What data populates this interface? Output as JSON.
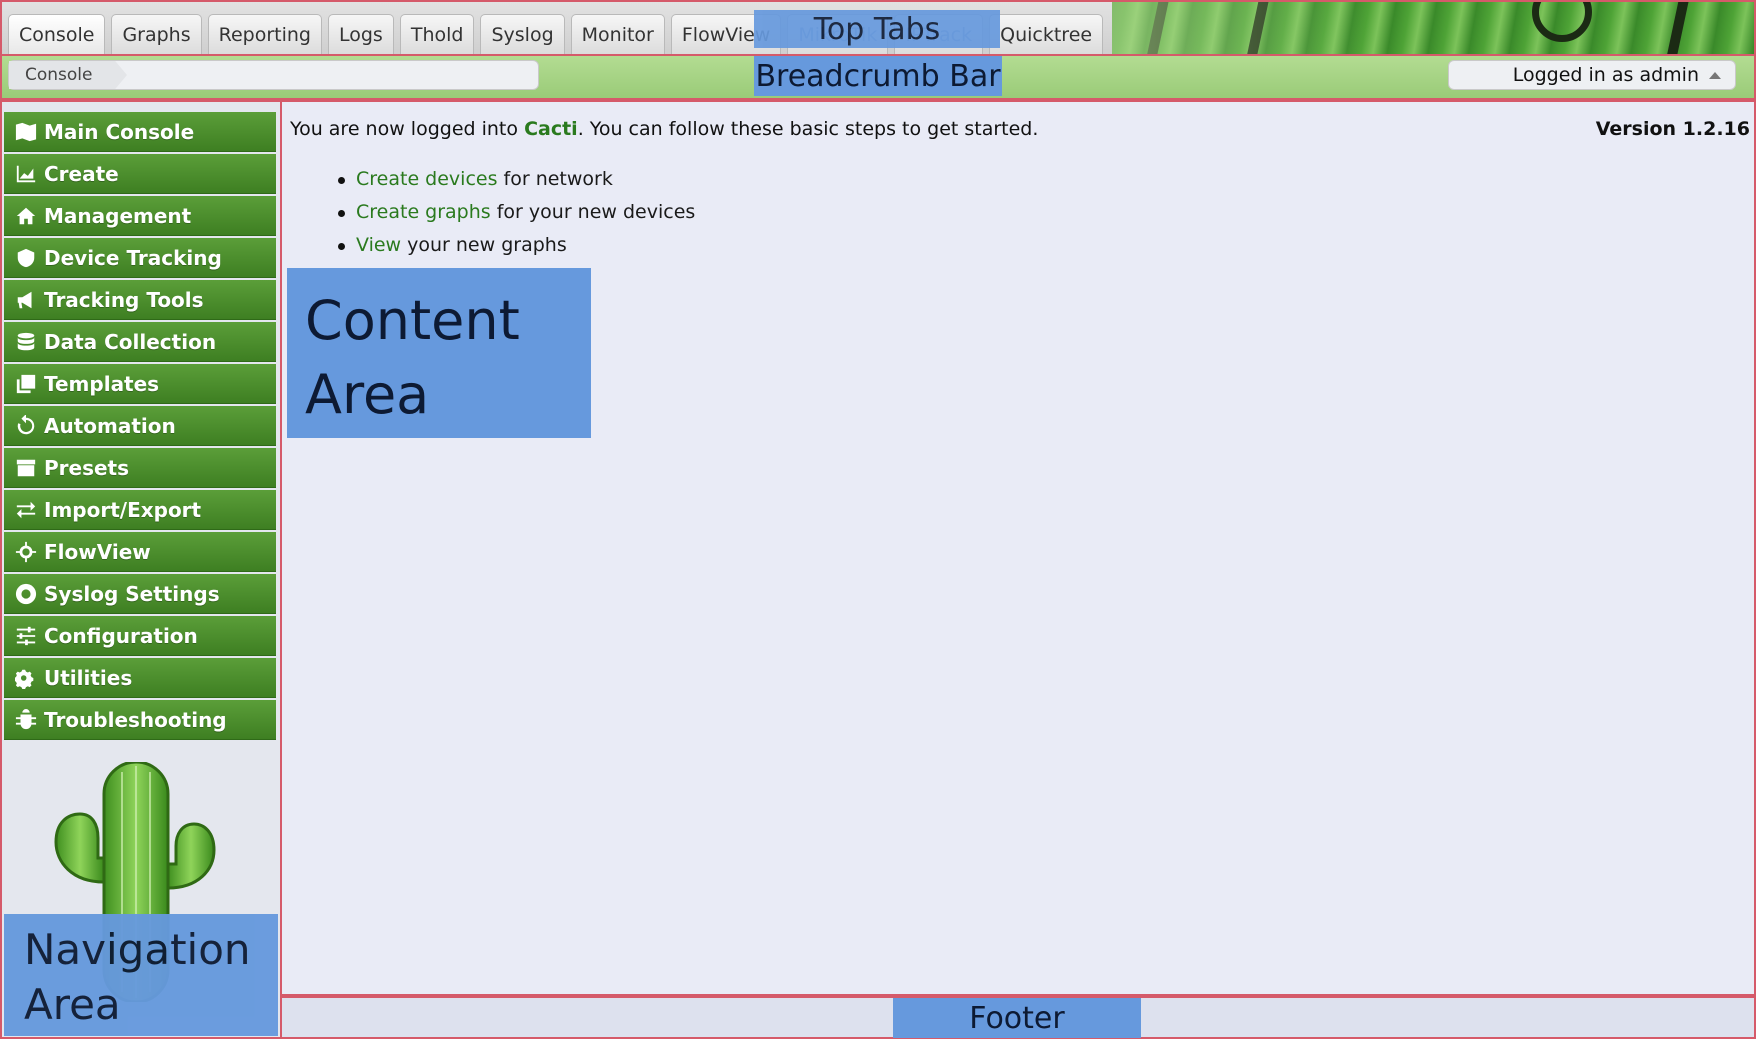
{
  "top_tabs": [
    {
      "label": "Console"
    },
    {
      "label": "Graphs"
    },
    {
      "label": "Reporting"
    },
    {
      "label": "Logs"
    },
    {
      "label": "Thold"
    },
    {
      "label": "Syslog"
    },
    {
      "label": "Monitor"
    },
    {
      "label": "FlowView"
    },
    {
      "label": "MikroTik"
    },
    {
      "label": "IPTrack"
    },
    {
      "label": "Quicktree"
    }
  ],
  "breadcrumb": {
    "current": "Console"
  },
  "user_menu": {
    "label": "Logged in as admin"
  },
  "nav": {
    "items": [
      {
        "label": "Main Console",
        "icon": "map-icon"
      },
      {
        "label": "Create",
        "icon": "area-chart-icon"
      },
      {
        "label": "Management",
        "icon": "home-icon"
      },
      {
        "label": "Device Tracking",
        "icon": "shield-icon"
      },
      {
        "label": "Tracking Tools",
        "icon": "bullhorn-icon"
      },
      {
        "label": "Data Collection",
        "icon": "database-icon"
      },
      {
        "label": "Templates",
        "icon": "clone-icon"
      },
      {
        "label": "Automation",
        "icon": "refresh-icon"
      },
      {
        "label": "Presets",
        "icon": "archive-icon"
      },
      {
        "label": "Import/Export",
        "icon": "exchange-icon"
      },
      {
        "label": "FlowView",
        "icon": "crosshairs-icon"
      },
      {
        "label": "Syslog Settings",
        "icon": "life-ring-icon"
      },
      {
        "label": "Configuration",
        "icon": "sliders-icon"
      },
      {
        "label": "Utilities",
        "icon": "cogs-icon"
      },
      {
        "label": "Troubleshooting",
        "icon": "bug-icon"
      }
    ]
  },
  "content": {
    "welcome_prefix": "You are now logged into ",
    "brand": "Cacti",
    "welcome_suffix": ". You can follow these basic steps to get started.",
    "version": "Version 1.2.16",
    "steps": [
      {
        "link": "Create devices",
        "text": " for network"
      },
      {
        "link": "Create graphs",
        "text": " for your new devices"
      },
      {
        "link": "View",
        "text": " your new graphs"
      }
    ]
  },
  "annotations": {
    "top_tabs": "Top Tabs",
    "breadcrumb_bar": "Breadcrumb Bar",
    "content_area_line1": "Content",
    "content_area_line2": "Area",
    "navigation_area_line1": "Navigation",
    "navigation_area_line2": "Area",
    "footer": "Footer"
  },
  "colors": {
    "nav_green": "#4a8e2c",
    "link_green": "#2a7a1e",
    "annotation_blue": "#6699dd",
    "region_border": "#d55a6a"
  }
}
